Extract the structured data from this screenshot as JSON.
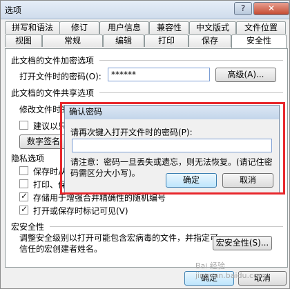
{
  "window": {
    "title": "选项",
    "help_label": "?",
    "close_label": "✕"
  },
  "tabs": {
    "row1": [
      "拼写和语法",
      "修订",
      "用户信息",
      "兼容性",
      "中文版式",
      "文件位置"
    ],
    "row2": [
      "视图",
      "常规",
      "编辑",
      "打印",
      "保存",
      "安全性"
    ]
  },
  "security": {
    "encrypt_section": "此文档的文件加密选项",
    "open_password_label": "打开文件时的密码(O):",
    "open_password_value": "******",
    "advanced_button": "高级(A)...",
    "share_section": "此文档的文件共享选项",
    "modify_password_label": "修改文件时的",
    "recommend_label": "建议以只",
    "digital_sig_button": "数字签名",
    "privacy_section": "隐私选项",
    "privacy_items": [
      {
        "label": "保存时从",
        "checked": false
      },
      {
        "label": "打印、保",
        "checked": false
      },
      {
        "label": "存储用于增强合并精确性的随机编号",
        "checked": true
      },
      {
        "label": "打开或保存时标记可见(V)",
        "checked": true
      }
    ],
    "macro_section": "宏安全性",
    "macro_desc": "调整安全级别以打开可能包含宏病毒的文件，并指定可信任的宏创建者姓名。",
    "macro_button": "宏安全性(S)..."
  },
  "footer": {
    "ok_label": "确定",
    "cancel_label": "取消"
  },
  "dialog": {
    "title": "确认密码",
    "prompt": "请再次键入打开文件时的密码(P):",
    "note": "请注意：密码一旦丢失或遗忘，则无法恢复。(请记住密码需区分大小写)。",
    "ok_label": "确定",
    "cancel_label": "取消"
  },
  "watermark": "Bai 经验 jingyan.baidu.com",
  "colors": {
    "highlight_frame": "#e8262b",
    "default_button": "#bee6fd"
  }
}
